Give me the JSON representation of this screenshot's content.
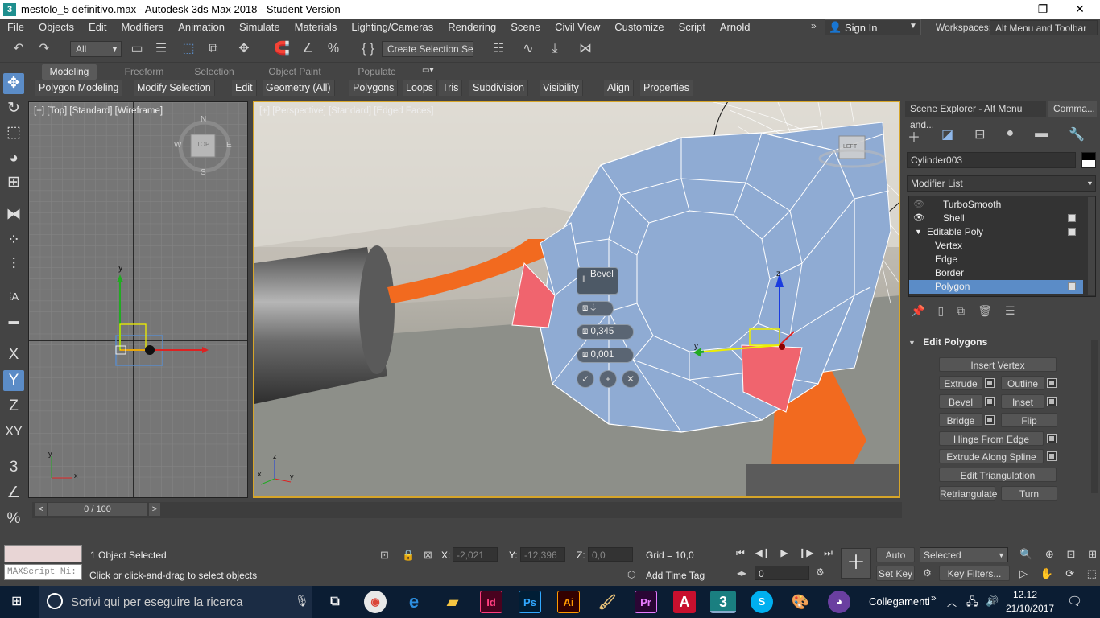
{
  "window": {
    "title": "mestolo_5 definitivo.max - Autodesk 3ds Max 2018 - Student Version",
    "app_icon": "3",
    "minimize": "—",
    "maximize": "❐",
    "close": "✕"
  },
  "menu": {
    "items": [
      "File",
      "Objects",
      "Edit",
      "Modifiers",
      "Animation",
      "Simulate",
      "Materials",
      "Lighting/Cameras",
      "Rendering",
      "Scene",
      "Civil View",
      "Customize",
      "Script",
      "Arnold"
    ],
    "more": "»",
    "sign_in": "Sign In",
    "workspaces_label": "Workspaces:",
    "workspace_value": "Alt Menu and Toolbar"
  },
  "toolbar": {
    "filter_value": "All",
    "selection_set_placeholder": "Create Selection Se"
  },
  "ribbon": {
    "tabs": [
      "Modeling",
      "Freeform",
      "Selection",
      "Object Paint",
      "Populate"
    ],
    "buttons": [
      "Polygon Modeling",
      "Modify Selection",
      "Edit",
      "Geometry (All)",
      "Polygons",
      "Loops",
      "Tris",
      "Subdivision",
      "Visibility",
      "Align",
      "Properties"
    ]
  },
  "left_tools": [
    "X",
    "Y",
    "Z",
    "XY"
  ],
  "viewport_top": {
    "label": "[+] [Top] [Standard] [Wireframe]",
    "viewcube_face": "TOP",
    "compass": {
      "n": "N",
      "s": "S",
      "e": "E",
      "w": "W"
    },
    "axis_y": "y",
    "axis_x": "x"
  },
  "viewport_persp": {
    "label": "[+] [Perspective] [Standard] [Edged Faces]",
    "viewcube_face": "LEFT",
    "caddy": {
      "title": "Bevel",
      "height_value": "0,345",
      "outline_value": "0,001"
    },
    "axis_z": "z",
    "axis_x": "x",
    "axis_y": "y"
  },
  "right_panel": {
    "tab_scene_explorer": "Scene Explorer - Alt Menu and...",
    "tab_command": "Comma...",
    "object_name": "Cylinder003",
    "modifier_list": "Modifier List",
    "stack": [
      {
        "label": "TurboSmooth",
        "indent": 1
      },
      {
        "label": "Shell",
        "indent": 1
      },
      {
        "label": "Editable Poly",
        "indent": 0
      },
      {
        "label": "Vertex",
        "indent": 2
      },
      {
        "label": "Edge",
        "indent": 2
      },
      {
        "label": "Border",
        "indent": 2
      },
      {
        "label": "Polygon",
        "indent": 2
      }
    ],
    "rollout_title": "Edit Polygons",
    "buttons": {
      "insert_vertex": "Insert Vertex",
      "extrude": "Extrude",
      "outline": "Outline",
      "bevel": "Bevel",
      "inset": "Inset",
      "bridge": "Bridge",
      "flip": "Flip",
      "hinge": "Hinge From Edge",
      "extrude_spline": "Extrude Along Spline",
      "edit_tri": "Edit Triangulation",
      "retriangulate": "Retriangulate",
      "turn": "Turn"
    }
  },
  "timeline": {
    "frame": "0 / 100",
    "prev": "<",
    "next": ">"
  },
  "status": {
    "maxscript": "MAXScript Mi:",
    "selected": "1 Object Selected",
    "prompt": "Click or click-and-drag to select objects",
    "x_label": "X:",
    "x_value": "-2,021",
    "y_label": "Y:",
    "y_value": "-12,396",
    "z_label": "Z:",
    "z_value": "0,0",
    "grid": "Grid = 10,0",
    "add_time_tag": "Add Time Tag",
    "auto_key": "Auto Key",
    "set_key": "Set Key",
    "key_mode": "Selected",
    "key_filters": "Key Filters...",
    "frame_value": "0"
  },
  "taskbar": {
    "search_placeholder": "Scrivi qui per eseguire la ricerca",
    "apps": [
      "Id",
      "Ps",
      "Ai",
      "Pr",
      "A",
      "3"
    ],
    "links": "Collegamenti",
    "time": "12.12",
    "date": "21/10/2017"
  },
  "colors": {
    "selection_blue": "#5b8cc7",
    "viewport_border": "#d6a529",
    "model_blue": "#8fabd3",
    "selected_face": "#f0646e",
    "orange_handle": "#f26a1f"
  }
}
